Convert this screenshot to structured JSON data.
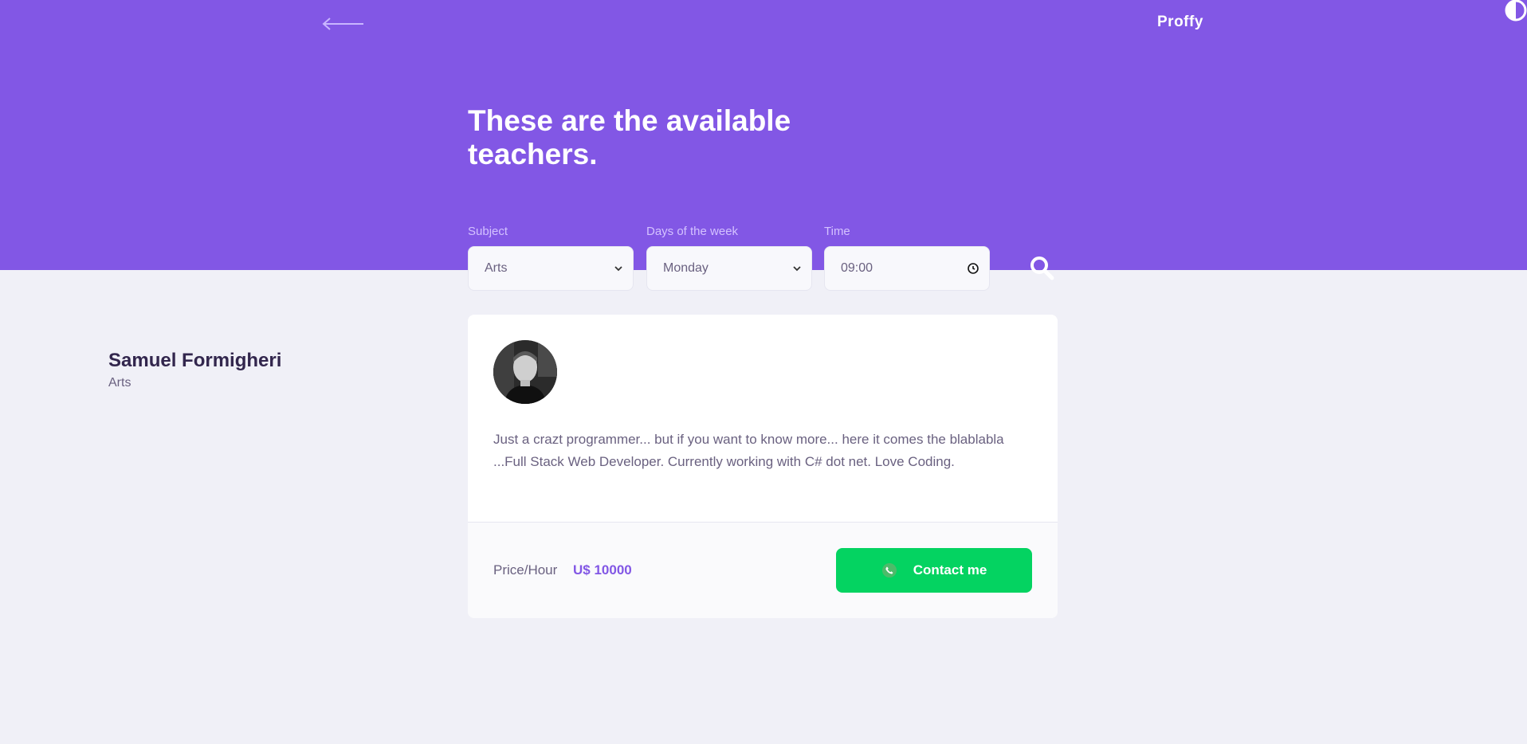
{
  "header": {
    "logo": "Proffy",
    "title": "These are the available teachers.",
    "accent_color": "#8257e5"
  },
  "filters": {
    "subject": {
      "label": "Subject",
      "value": "Arts"
    },
    "week_day": {
      "label": "Days of the week",
      "value": "Monday"
    },
    "time": {
      "label": "Time",
      "value": "09:00"
    }
  },
  "teacher": {
    "name": "Samuel Formigheri",
    "subject": "Arts",
    "bio": "Just a crazt programmer... but if you want to know more... here it comes the blablabla ...Full Stack Web Developer. Currently working with C# dot net. Love Coding.",
    "price_label": "Price/Hour",
    "price_value": "U$ 10000",
    "contact_label": "Contact me",
    "contact_color": "#04d361"
  },
  "icons": {
    "back": "arrow-left-icon",
    "theme": "half-circle-icon",
    "search": "magnifier-icon",
    "dropdown": "chevron-down-icon",
    "clock": "clock-icon",
    "phone": "whatsapp-icon"
  }
}
